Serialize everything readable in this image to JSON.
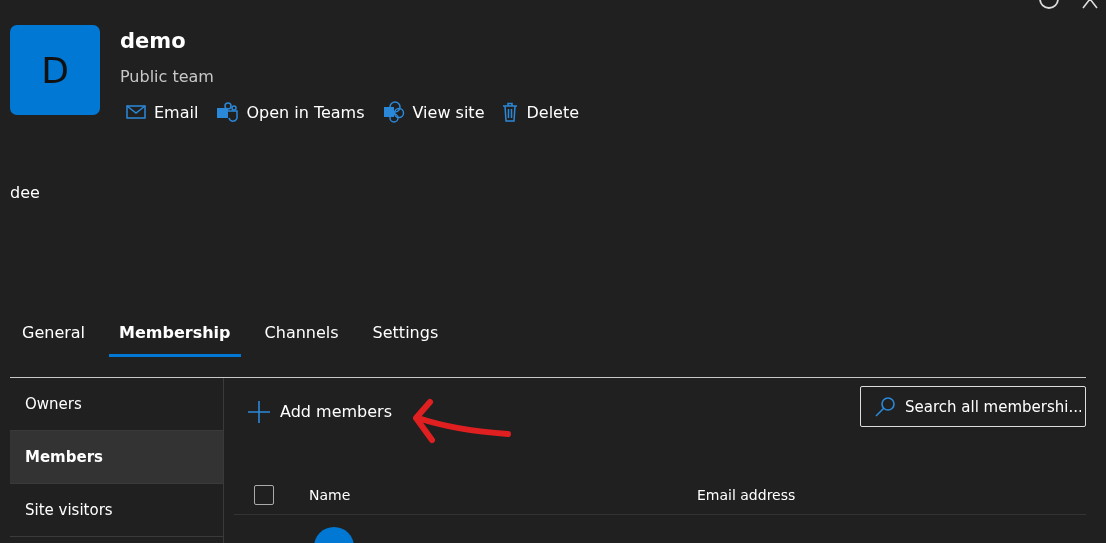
{
  "team": {
    "initial": "D",
    "name": "demo",
    "privacy": "Public team",
    "description": "dee"
  },
  "actions": [
    {
      "kind": "email",
      "label": "Email"
    },
    {
      "kind": "teams",
      "label": "Open in Teams"
    },
    {
      "kind": "site",
      "label": "View site"
    },
    {
      "kind": "delete",
      "label": "Delete"
    }
  ],
  "tabs": [
    {
      "label": "General",
      "selected": false
    },
    {
      "label": "Membership",
      "selected": true
    },
    {
      "label": "Channels",
      "selected": false
    },
    {
      "label": "Settings",
      "selected": false
    }
  ],
  "sidebar": {
    "items": [
      {
        "label": "Owners",
        "selected": false
      },
      {
        "label": "Members",
        "selected": true
      },
      {
        "label": "Site visitors",
        "selected": false
      }
    ]
  },
  "toolbar": {
    "add_label": "Add members",
    "search": {
      "placeholder": "Search all membershi..."
    }
  },
  "table": {
    "select_all": {
      "checked": false
    },
    "columns": [
      "Name",
      "Email address"
    ]
  }
}
